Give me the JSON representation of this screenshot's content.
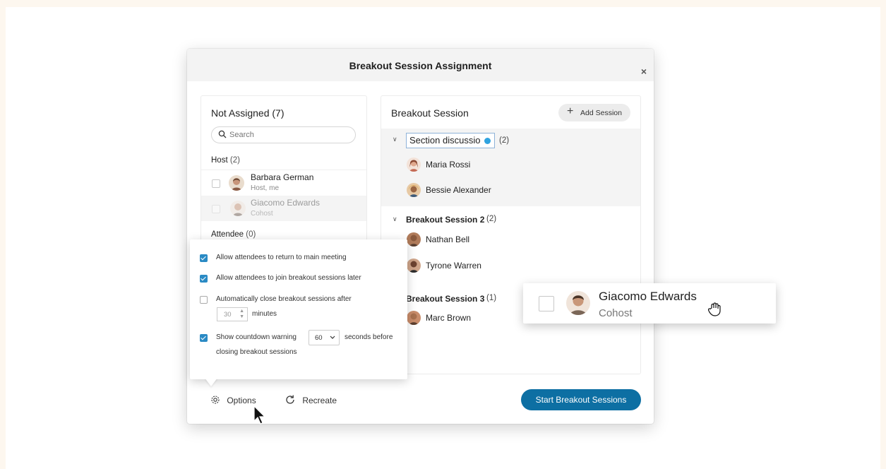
{
  "dialog": {
    "title": "Breakout Session Assignment",
    "close_glyph": "×"
  },
  "not_assigned": {
    "title": "Not Assigned",
    "count": "(7)",
    "search_placeholder": "Search",
    "host_heading": "Host",
    "host_count": "(2)",
    "hosts": [
      {
        "name": "Barbara German",
        "role": "Host, me"
      },
      {
        "name": "Giacomo Edwards",
        "role": "Cohost"
      }
    ],
    "attendee_heading": "Attendee",
    "attendee_count": "(0)"
  },
  "breakout": {
    "title": "Breakout Session",
    "add_session_label": "Add Session",
    "sessions": [
      {
        "name": "Section discussio",
        "count": "(2)",
        "editing": true,
        "members": [
          "Maria Rossi",
          "Bessie Alexander"
        ]
      },
      {
        "name": "Breakout Session 2",
        "count": "(2)",
        "members": [
          "Nathan Bell",
          "Tyrone Warren"
        ]
      },
      {
        "name": "Breakout Session 3",
        "count": "(1)",
        "members": [
          "Marc Brown"
        ]
      }
    ]
  },
  "options": {
    "items": [
      {
        "label": "Allow attendees to return to main meeting",
        "checked": true
      },
      {
        "label": "Allow attendees to join breakout sessions later",
        "checked": true
      },
      {
        "label": "Automatically close breakout sessions after",
        "checked": false,
        "value": "30",
        "unit": "minutes"
      },
      {
        "label": "Show countdown warning",
        "checked": true,
        "value": "60",
        "suffix": "seconds before",
        "suffix2": "closing breakout sessions"
      }
    ]
  },
  "footer": {
    "options_label": "Options",
    "recreate_label": "Recreate",
    "start_label": "Start Breakout Sessions"
  },
  "drag_card": {
    "name": "Giacomo Edwards",
    "role": "Cohost"
  },
  "colors": {
    "accent": "#0d6fa3",
    "checkbox": "#2a8ac4",
    "page_bg": "#fdf7ef"
  }
}
